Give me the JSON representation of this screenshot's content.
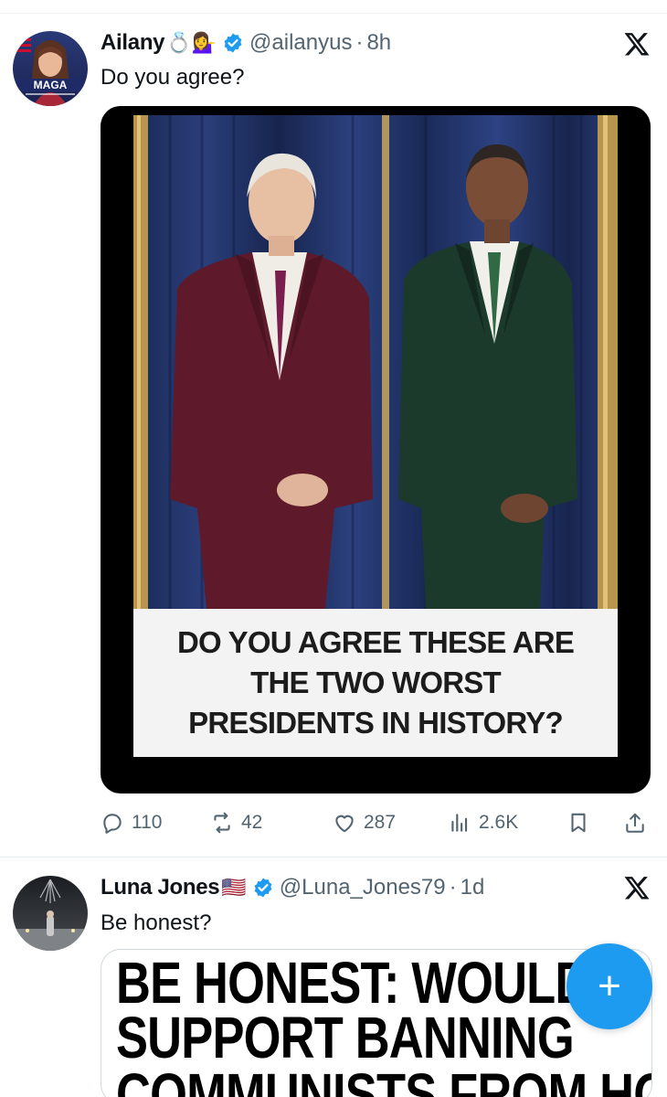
{
  "tweets": [
    {
      "name": "Ailany",
      "emojis": "💍💁‍♀️",
      "handle": "@ailanyus",
      "separator": "·",
      "time": "8h",
      "text": "Do you agree?",
      "avatar_badge": "MAGA",
      "media_caption": [
        "DO YOU AGREE THESE ARE",
        "THE TWO WORST",
        "PRESIDENTS IN HISTORY?"
      ],
      "stats": {
        "replies": "110",
        "reposts": "42",
        "likes": "287",
        "views": "2.6K"
      }
    },
    {
      "name": "Luna Jones",
      "emojis": "🇺🇸",
      "handle": "@Luna_Jones79",
      "separator": "·",
      "time": "1d",
      "text": "Be honest?",
      "media_lines": [
        "BE HONEST: WOULD Y",
        "SUPPORT BANNING",
        "COMMUNISTS FROM HOLDING"
      ]
    }
  ],
  "fab": {
    "label": "+"
  },
  "colors": {
    "accent": "#1d9bf0",
    "secondary_text": "#536471"
  },
  "icons": [
    "verified-badge-icon",
    "x-logo-icon",
    "reply-icon",
    "repost-icon",
    "like-icon",
    "views-icon",
    "bookmark-icon",
    "share-icon",
    "plus-icon"
  ]
}
